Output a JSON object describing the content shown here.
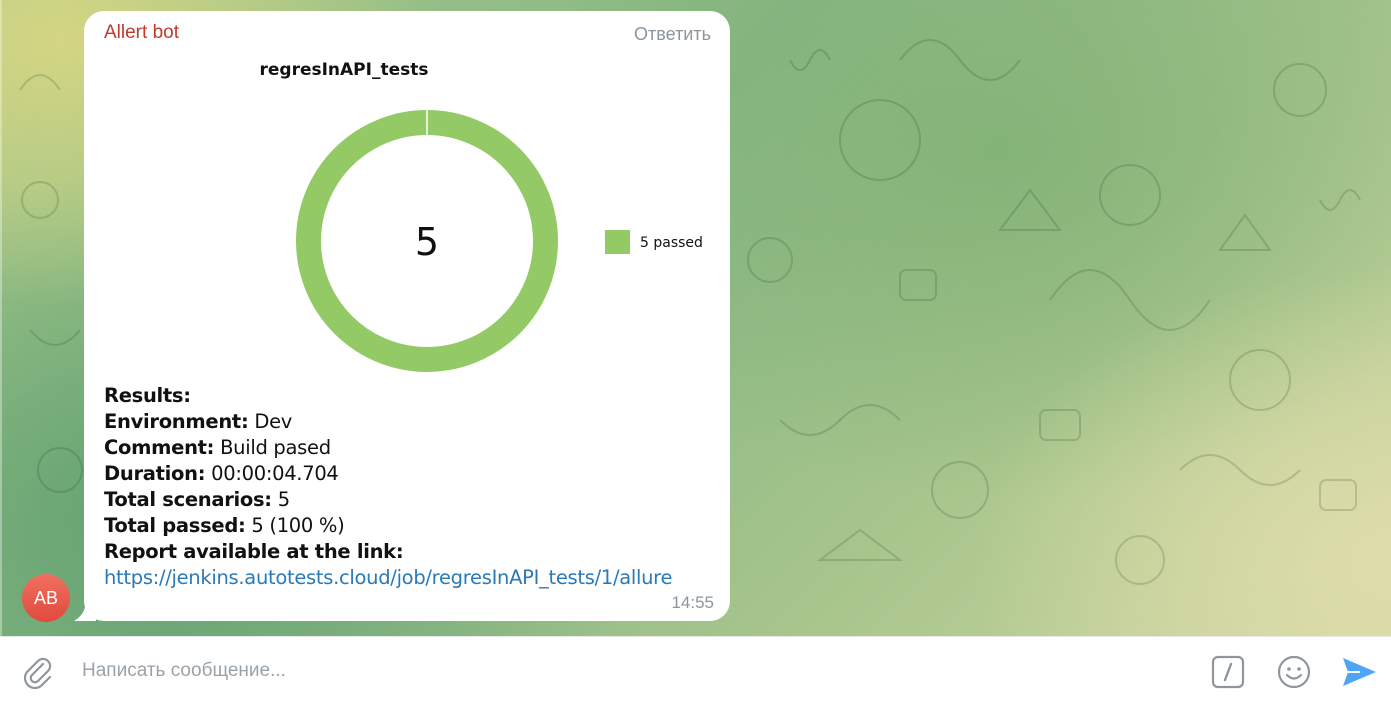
{
  "message": {
    "sender": "Allert bot",
    "reply_label": "Ответить",
    "time": "14:55",
    "avatar_initials": "AB",
    "results": {
      "heading": "Results:",
      "environment_label": "Environment:",
      "environment_value": " Dev",
      "comment_label": "Comment:",
      "comment_value": " Build pased",
      "duration_label": "Duration:",
      "duration_value": " 00:00:04.704",
      "scenarios_label": "Total scenarios:",
      "scenarios_value": " 5",
      "passed_label": "Total passed:",
      "passed_value": " 5 (100 %)",
      "report_label": "Report available at the link:",
      "report_link": "https://jenkins.autotests.cloud/job/regresInAPI_tests/1/allure"
    }
  },
  "chart_data": {
    "type": "pie",
    "title": "regresInAPI_tests",
    "center_label": "5",
    "legend_position": "right",
    "slices": [
      {
        "label": "5 passed",
        "value": 5,
        "color": "#94ca66"
      }
    ]
  },
  "composer": {
    "placeholder": "Написать сообщение..."
  },
  "colors": {
    "sender": "#c0392b",
    "link": "#2a7ab8",
    "passed": "#94ca66",
    "send": "#4ea4f6"
  }
}
